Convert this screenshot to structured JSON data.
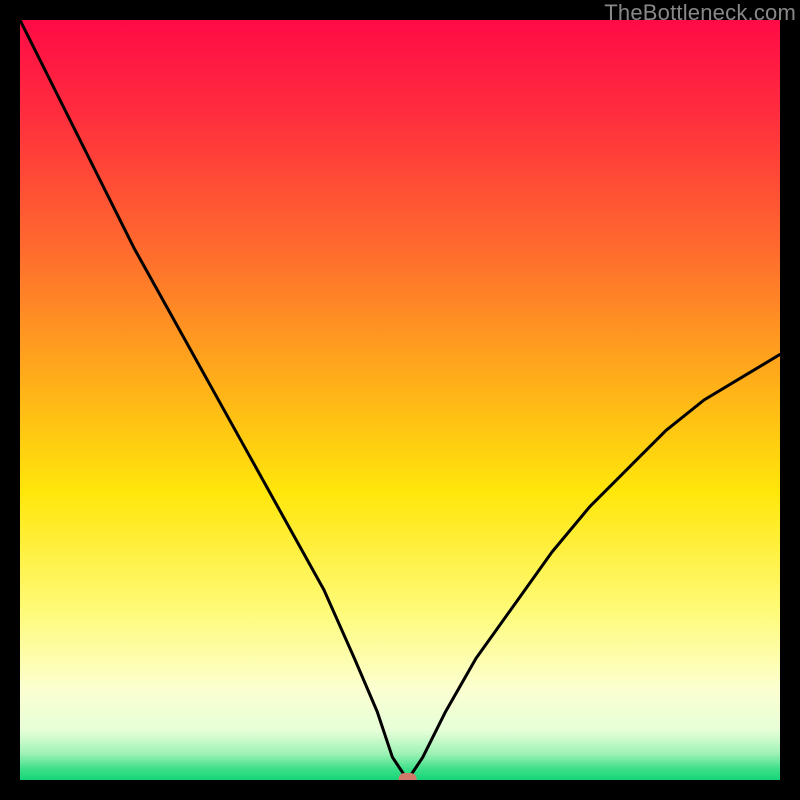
{
  "watermark": "TheBottleneck.com",
  "chart_data": {
    "type": "line",
    "title": "",
    "xlabel": "",
    "ylabel": "",
    "xlim": [
      0,
      100
    ],
    "ylim": [
      0,
      100
    ],
    "x_semantic": "component balance parameter (normalized)",
    "y_semantic": "bottleneck percentage",
    "x_annotation_guess": "GPU relative performance share (left = CPU-heavy, right = GPU-heavy)",
    "optimum_x": 51,
    "optimum_y": 0,
    "series": [
      {
        "name": "bottleneck-curve",
        "x": [
          0,
          5,
          10,
          15,
          20,
          25,
          30,
          35,
          40,
          44,
          47,
          49,
          51,
          53,
          56,
          60,
          65,
          70,
          75,
          80,
          85,
          90,
          95,
          100
        ],
        "values": [
          100,
          90,
          80,
          70,
          61,
          52,
          43,
          34,
          25,
          16,
          9,
          3,
          0,
          3,
          9,
          16,
          23,
          30,
          36,
          41,
          46,
          50,
          53,
          56
        ]
      }
    ],
    "marker": {
      "x": 51,
      "y": 0,
      "color": "#cf7a6a"
    },
    "background_gradient": {
      "stops": [
        {
          "offset": 0.0,
          "color": "#ff0b46"
        },
        {
          "offset": 0.12,
          "color": "#ff2c3e"
        },
        {
          "offset": 0.3,
          "color": "#ff6a2e"
        },
        {
          "offset": 0.48,
          "color": "#ffb019"
        },
        {
          "offset": 0.62,
          "color": "#ffe60a"
        },
        {
          "offset": 0.78,
          "color": "#fffb7a"
        },
        {
          "offset": 0.88,
          "color": "#fcffd0"
        },
        {
          "offset": 0.935,
          "color": "#e6ffd8"
        },
        {
          "offset": 0.965,
          "color": "#9ff2b6"
        },
        {
          "offset": 0.985,
          "color": "#3fe08a"
        },
        {
          "offset": 1.0,
          "color": "#15d478"
        }
      ]
    },
    "grid": false,
    "legend": false
  }
}
